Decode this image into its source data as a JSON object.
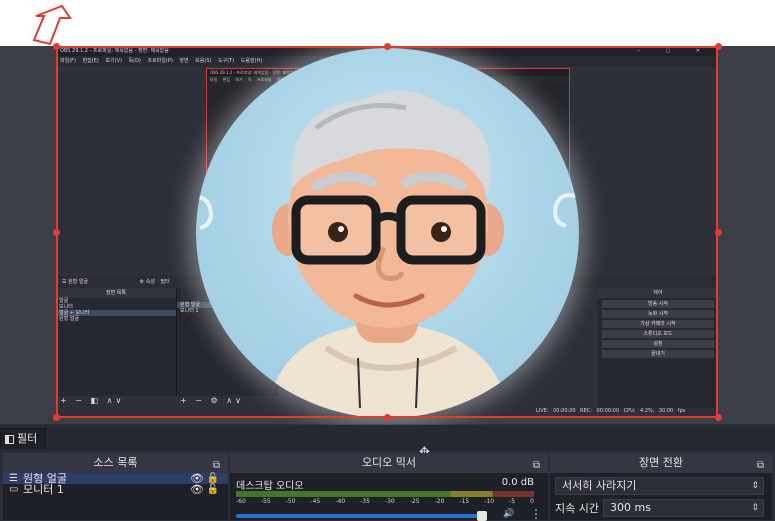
{
  "captured_window": {
    "title": "OBS 29.1.2 - 프로파일: 제목없음 - 장면: 제목없음",
    "menu": "파일(F) 편집(E) 보기(V) 독(D) 프로파일(P) 장면 모음(S) 도구(T) 도움말(H)",
    "window_buttons": "– ▢ ✕",
    "inner_title": "OBS 29.1.2 - 프로파일: 제목없음 - 장면: 제목없음",
    "inner_menu": "파일 편집 보기 독 프로파일 장면모음 도구 도움말",
    "toolbar_text": "원형 얼굴",
    "toolbar_props": "속성",
    "toolbar_filters": "필터",
    "scenes_header": "장면 목록",
    "scene_rows": [
      "얼굴",
      "모니터",
      "얼굴 + 모니터",
      "원형 얼굴"
    ],
    "sources_rows": [
      "원형 얼굴",
      "모니터 1"
    ],
    "controls_header": "제어",
    "controls_buttons": [
      "방송 시작",
      "녹화 시작",
      "가상 카메라 시작",
      "스튜디오 모드",
      "설정",
      "끝내기"
    ],
    "status": "LIVE: 00:00:00  REC: 00:00:00  CPU: 4.2%, 30.00 fps"
  },
  "filter_tab": {
    "label": "필터"
  },
  "sources_dock": {
    "title": "소스 목록",
    "items": [
      {
        "icon": "list-icon",
        "label": "원형 얼굴",
        "selected": true
      },
      {
        "icon": "monitor-icon",
        "label": "모니터 1",
        "selected": false
      }
    ]
  },
  "mixer_dock": {
    "title": "오디오 믹서",
    "channel": "데스크탑 오디오",
    "level": "0.0 dB",
    "ticks": [
      "-60",
      "-55",
      "-50",
      "-45",
      "-40",
      "-35",
      "-30",
      "-25",
      "-20",
      "-15",
      "-10",
      "-5",
      "0"
    ],
    "volume_fraction": 0.95
  },
  "transition_dock": {
    "title": "장면 전환",
    "selected": "서서히 사라지기",
    "duration_label": "지속 시간",
    "duration_value": "300 ms"
  },
  "colors": {
    "selection": "#e33b2e",
    "dock_bg": "#1e2027",
    "selected_row": "#2c3e66"
  }
}
